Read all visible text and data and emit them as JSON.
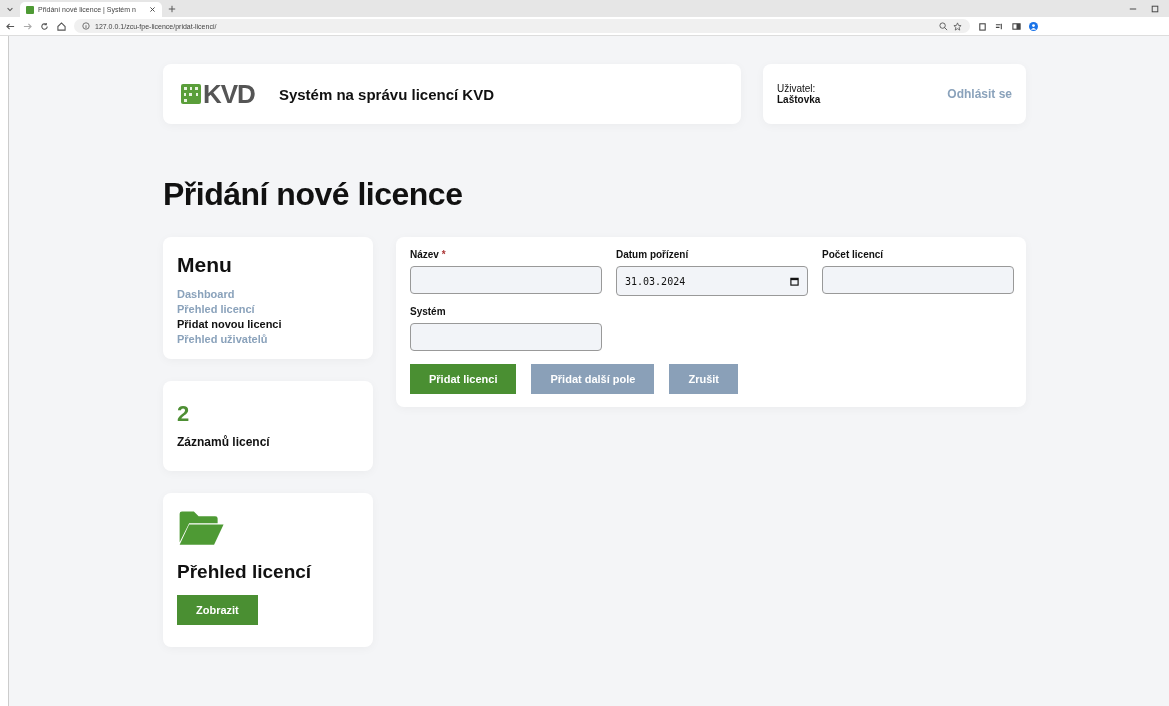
{
  "browser": {
    "tab_title": "Přidání nové licence | Systém n",
    "url": "127.0.0.1/zcu-fpe-licence/pridat-licenci/"
  },
  "header": {
    "logo": "KVD",
    "title": "Systém na správu licencí KVD",
    "user_label": "Uživatel:",
    "user_name": "Laštovka",
    "logout": "Odhlásit se"
  },
  "page_title": "Přidání nové licence",
  "menu": {
    "title": "Menu",
    "items": [
      {
        "label": "Dashboard",
        "selected": false
      },
      {
        "label": "Přehled licencí",
        "selected": false
      },
      {
        "label": "Přidat novou licenci",
        "selected": true
      },
      {
        "label": "Přehled uživatelů",
        "selected": false
      }
    ]
  },
  "stats": {
    "count": "2",
    "label": "Záznamů licencí"
  },
  "overview": {
    "title": "Přehled licencí",
    "button": "Zobrazit"
  },
  "form": {
    "fields": [
      {
        "label": "Název",
        "required_mark": "*",
        "kind": "text"
      },
      {
        "label": "Datum pořízení",
        "kind": "date",
        "value": "31.03.2024"
      },
      {
        "label": "Počet licencí",
        "kind": "text"
      },
      {
        "label": "Systém",
        "kind": "text"
      }
    ],
    "buttons": [
      {
        "label": "Přidat licenci",
        "kind": "primary"
      },
      {
        "label": "Přidat další pole",
        "kind": "secondary"
      },
      {
        "label": "Zrušit",
        "kind": "secondary"
      }
    ]
  }
}
